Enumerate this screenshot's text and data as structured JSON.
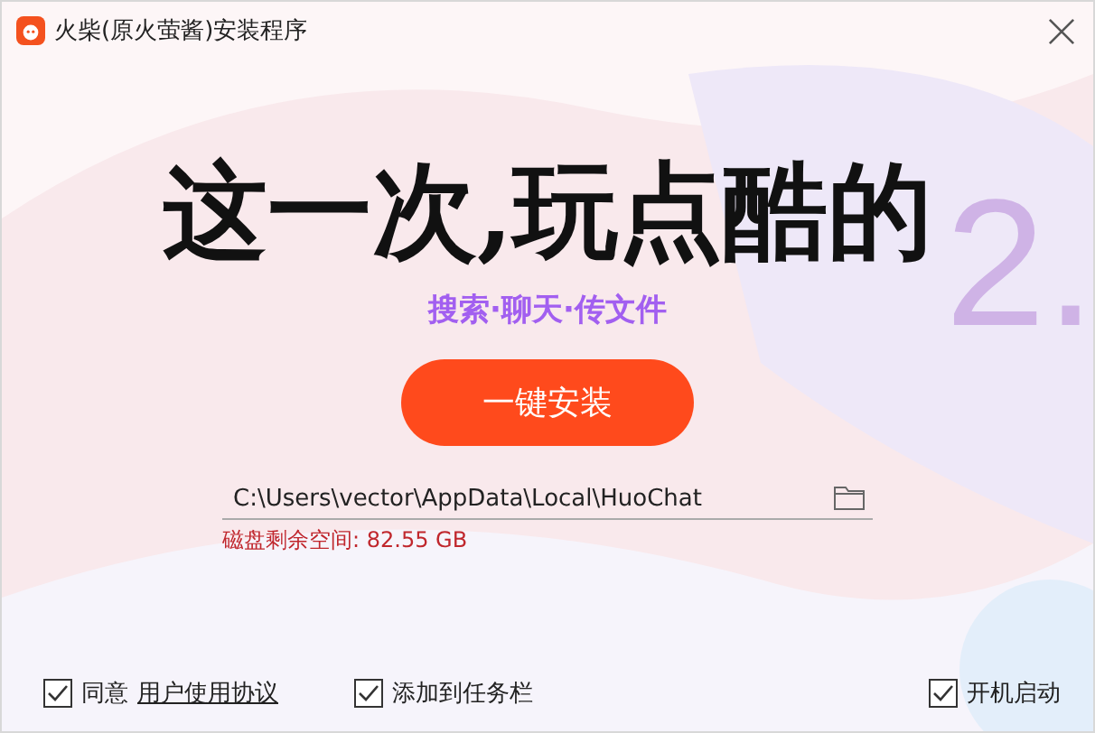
{
  "window": {
    "title": "火柴(原火萤酱)安装程序"
  },
  "watermark": "2.",
  "headline": "这一次,玩点酷的",
  "tagline": "搜索·聊天·传文件",
  "install_button": "一键安装",
  "install_path": {
    "value": "C:\\Users\\vector\\AppData\\Local\\HuoChat"
  },
  "disk_space": "磁盘剩余空间: 82.55 GB",
  "options": [
    {
      "label": "同意",
      "link": "用户使用协议",
      "checked": true
    },
    {
      "label": "添加到任务栏",
      "checked": true
    },
    {
      "label": "开机启动",
      "checked": true
    }
  ]
}
